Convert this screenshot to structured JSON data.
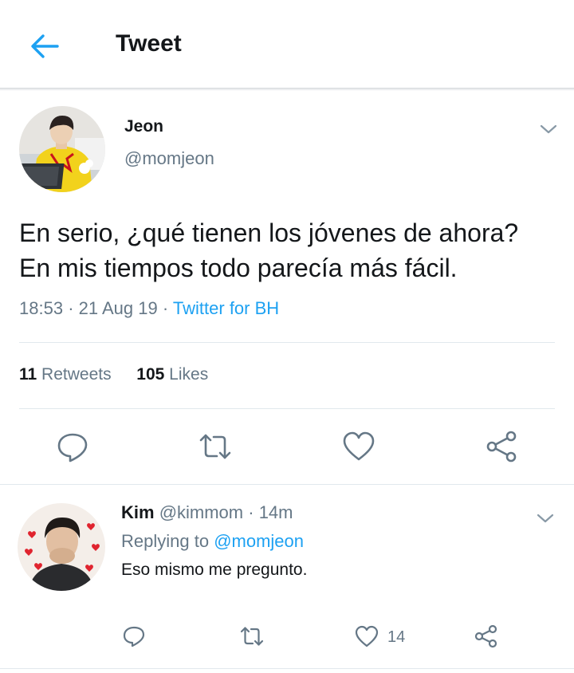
{
  "header": {
    "title": "Tweet",
    "back_icon": "back-arrow-icon",
    "accent": "#1da1f2"
  },
  "tweet": {
    "author_name": "Jeon",
    "author_handle": "@momjeon",
    "text_line1": "En serio, ¿qué tienen los jóvenes de ahora?",
    "text_line2": "En mis tiempos todo parecía más fácil.",
    "time": "18:53",
    "date": "21 Aug 19",
    "separator": "·",
    "source": "Twitter for BH",
    "retweets_count": "11",
    "retweets_label": "Retweets",
    "likes_count": "105",
    "likes_label": "Likes",
    "actions": [
      "reply-icon",
      "retweet-icon",
      "like-icon",
      "share-icon"
    ]
  },
  "reply": {
    "author_name": "Kim",
    "author_handle": "@kimmom",
    "time": "· 14m",
    "replying_prefix": "Replying to",
    "replying_handle": "@momjeon",
    "text": "Eso mismo me pregunto.",
    "like_count": "14",
    "actions": [
      "reply-icon",
      "retweet-icon",
      "like-icon",
      "share-icon"
    ]
  },
  "colors": {
    "text": "#14171a",
    "secondary": "#657786",
    "link": "#1da1f2",
    "border": "#e1e8ed"
  }
}
